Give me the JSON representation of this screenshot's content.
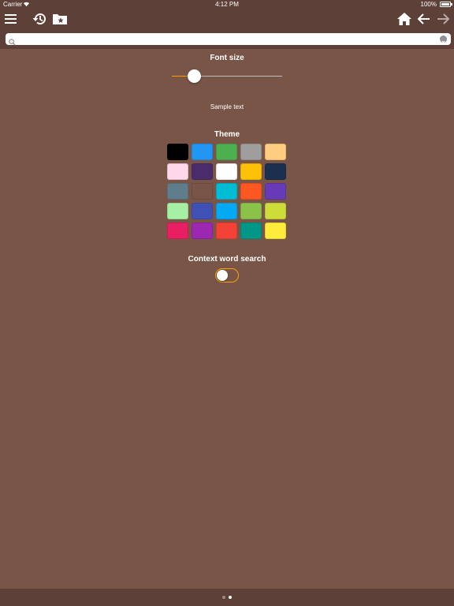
{
  "status_bar": {
    "carrier": "Carrier",
    "time": "4:12 PM",
    "battery": "100%"
  },
  "toolbar": {
    "icons": [
      "menu-icon",
      "history-icon",
      "bookmarks-folder-icon",
      "home-icon",
      "back-arrow-icon",
      "forward-arrow-icon"
    ],
    "forward_enabled": false
  },
  "search": {
    "value": "",
    "placeholder": ""
  },
  "settings": {
    "font_size_label": "Font size",
    "font_size_value": 0.16,
    "sample_text": "Sample text",
    "theme_label": "Theme",
    "theme_colors": [
      [
        "#000000",
        "#2196f3",
        "#4caf50",
        "#9e9e9e",
        "#ffcc80"
      ],
      [
        "#fdd7ea",
        "#4a2c6b",
        "#ffffff",
        "#ffc107",
        "#1b2f4e"
      ],
      [
        "#607d8b",
        "#795548",
        "#00bcd4",
        "#ff5722",
        "#673ab7"
      ],
      [
        "#a5f0a5",
        "#3f51b5",
        "#03a9f4",
        "#8bc34a",
        "#cddc39"
      ],
      [
        "#e91e63",
        "#9c27b0",
        "#f44336",
        "#009688",
        "#ffeb3b"
      ]
    ],
    "context_search_label": "Context word search",
    "context_search_enabled": false
  },
  "page_indicator": {
    "count": 2,
    "current": 2
  },
  "colors": {
    "background": "#795548",
    "bar": "#5d4037",
    "accent": "#ffa000"
  }
}
